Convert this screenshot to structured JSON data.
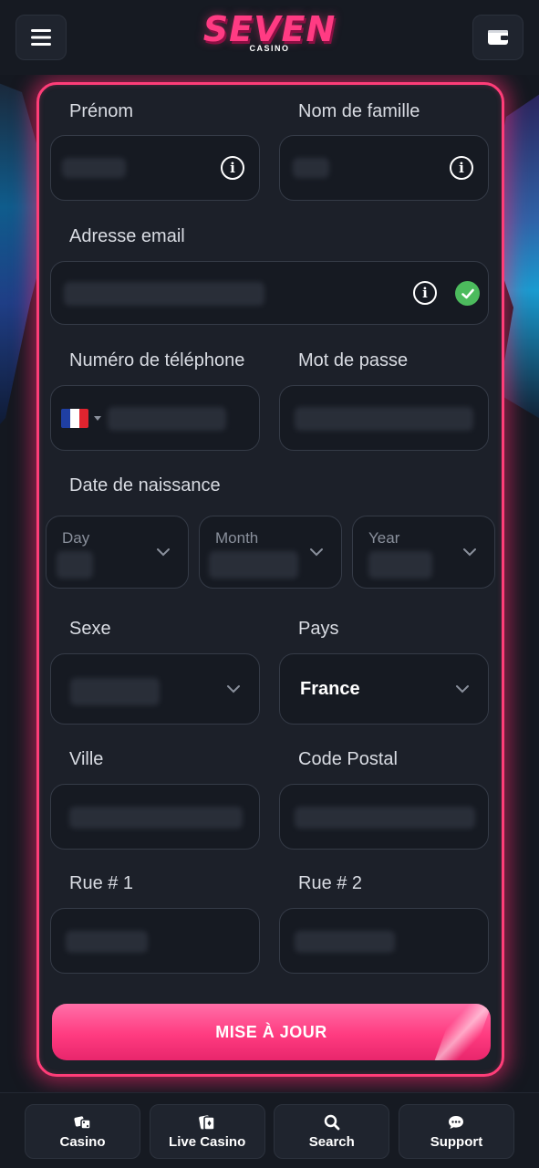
{
  "header": {
    "logo_main": "SEVEN",
    "logo_sub": "CASINO",
    "menu_icon": "hamburger-icon",
    "wallet_icon": "wallet-icon"
  },
  "form": {
    "first_name": {
      "label": "Prénom"
    },
    "last_name": {
      "label": "Nom de famille"
    },
    "email": {
      "label": "Adresse email"
    },
    "phone": {
      "label": "Numéro de téléphone",
      "country_flag": "FR"
    },
    "password": {
      "label": "Mot de passe"
    },
    "birth_date": {
      "label": "Date de naissance",
      "day_label": "Day",
      "month_label": "Month",
      "year_label": "Year"
    },
    "gender": {
      "label": "Sexe"
    },
    "country": {
      "label": "Pays",
      "value": "France"
    },
    "city": {
      "label": "Ville"
    },
    "postal_code": {
      "label": "Code Postal"
    },
    "street1": {
      "label": "Rue # 1"
    },
    "street2": {
      "label": "Rue # 2"
    },
    "submit_label": "MISE À JOUR"
  },
  "bottom_nav": {
    "items": [
      {
        "label": "Casino",
        "icon": "dice-icon"
      },
      {
        "label": "Live Casino",
        "icon": "cards-icon"
      },
      {
        "label": "Search",
        "icon": "search-icon"
      },
      {
        "label": "Support",
        "icon": "chat-icon"
      }
    ]
  },
  "colors": {
    "accent": "#ff3d78",
    "background": "#141820",
    "card": "#1c2029",
    "success": "#4cbb5d"
  }
}
